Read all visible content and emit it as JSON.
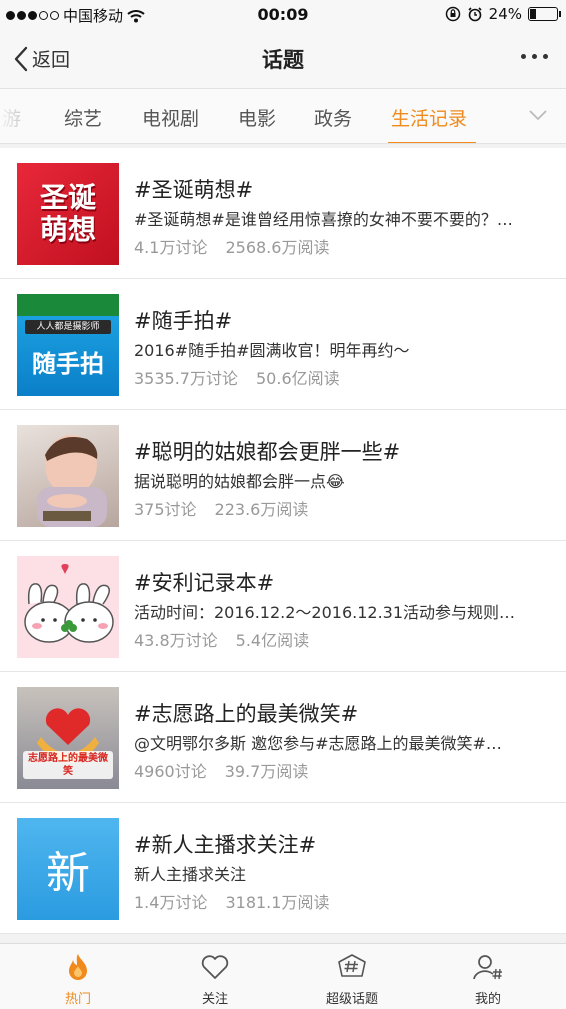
{
  "status_bar": {
    "carrier": "中国移动",
    "time": "00:09",
    "battery": "24%",
    "battery_level": 0.24
  },
  "nav": {
    "back_label": "返回",
    "title": "话题"
  },
  "tabs": [
    {
      "label": "游"
    },
    {
      "label": "综艺"
    },
    {
      "label": "电视剧"
    },
    {
      "label": "电影"
    },
    {
      "label": "政务"
    },
    {
      "label": "生活记录",
      "active": true
    }
  ],
  "topics": [
    {
      "thumb_text": "圣诞萌想",
      "title": "#圣诞萌想#",
      "desc": "#圣诞萌想#是谁曾经用惊喜撩的女神不要不要的？…",
      "discussions": "4.1万讨论",
      "reads": "2568.6万阅读"
    },
    {
      "thumb_text": "随手拍",
      "thumb_caption": "人人都是摄影师",
      "title": "#随手拍#",
      "desc": "2016#随手拍#圆满收官！明年再约～",
      "discussions": "3535.7万讨论",
      "reads": "50.6亿阅读"
    },
    {
      "title": "#聪明的姑娘都会更胖一些#",
      "desc": "据说聪明的姑娘都会胖一点😂",
      "discussions": "375讨论",
      "reads": "223.6万阅读"
    },
    {
      "title": "#安利记录本#",
      "desc": "活动时间：2016.12.2～2016.12.31活动参与规则…",
      "discussions": "43.8万讨论",
      "reads": "5.4亿阅读"
    },
    {
      "thumb_text": "志愿路上的最美微笑",
      "title": "#志愿路上的最美微笑#",
      "desc": "@文明鄂尔多斯 邀您参与#志愿路上的最美微笑#…",
      "discussions": "4960讨论",
      "reads": "39.7万阅读"
    },
    {
      "thumb_text": "新",
      "title": "#新人主播求关注#",
      "desc": "新人主播求关注",
      "discussions": "1.4万讨论",
      "reads": "3181.1万阅读"
    }
  ],
  "tab_bar": [
    {
      "label": "热门",
      "icon": "flame-icon",
      "active": true
    },
    {
      "label": "关注",
      "icon": "heart-icon"
    },
    {
      "label": "超级话题",
      "icon": "hashtag-icon"
    },
    {
      "label": "我的",
      "icon": "profile-icon"
    }
  ],
  "colors": {
    "accent": "#f08a1d",
    "text": "#222222",
    "muted": "#999999"
  }
}
